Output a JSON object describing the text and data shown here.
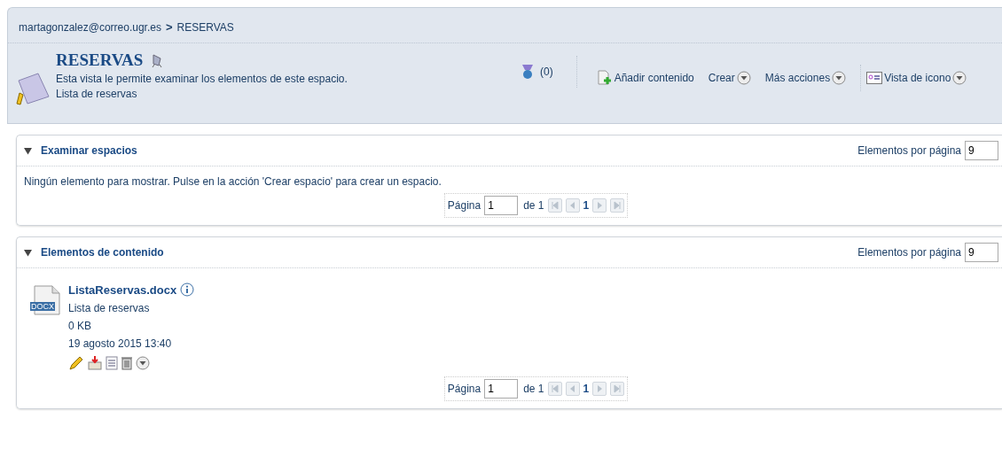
{
  "breadcrumb": {
    "items": [
      "martagonzalez@correo.ugr.es",
      "RESERVAS"
    ],
    "separator": ">"
  },
  "header": {
    "title": "RESERVAS",
    "description": "Esta vista le permite examinar los elementos de este espacio.",
    "subtitle": "Lista de reservas",
    "counter": "(0)",
    "actions": [
      {
        "kind": "add",
        "label": "Añadir contenido"
      },
      {
        "kind": "menu",
        "label": "Crear"
      },
      {
        "kind": "menu",
        "label": "Más acciones"
      },
      {
        "kind": "view",
        "label": "Vista de icono"
      }
    ]
  },
  "sections": [
    {
      "title": "Examinar espacios",
      "expanded": true,
      "per_page_label": "Elementos por página",
      "per_page": "9",
      "message": "Ningún elemento para mostrar. Pulse en la acción 'Crear espacio' para crear un espacio.",
      "pager": {
        "label": "Página",
        "value": "1",
        "of": "de 1",
        "current": "1"
      }
    },
    {
      "title": "Elementos de contenido",
      "expanded": true,
      "per_page_label": "Elementos por página",
      "per_page": "9",
      "items": [
        {
          "file_type": "DOCX",
          "name": "ListaReservas.docx",
          "description": "Lista de reservas",
          "size": "0 KB",
          "date": "19 agosto 2015 13:40"
        }
      ],
      "pager": {
        "label": "Página",
        "value": "1",
        "of": "de 1",
        "current": "1"
      }
    }
  ]
}
